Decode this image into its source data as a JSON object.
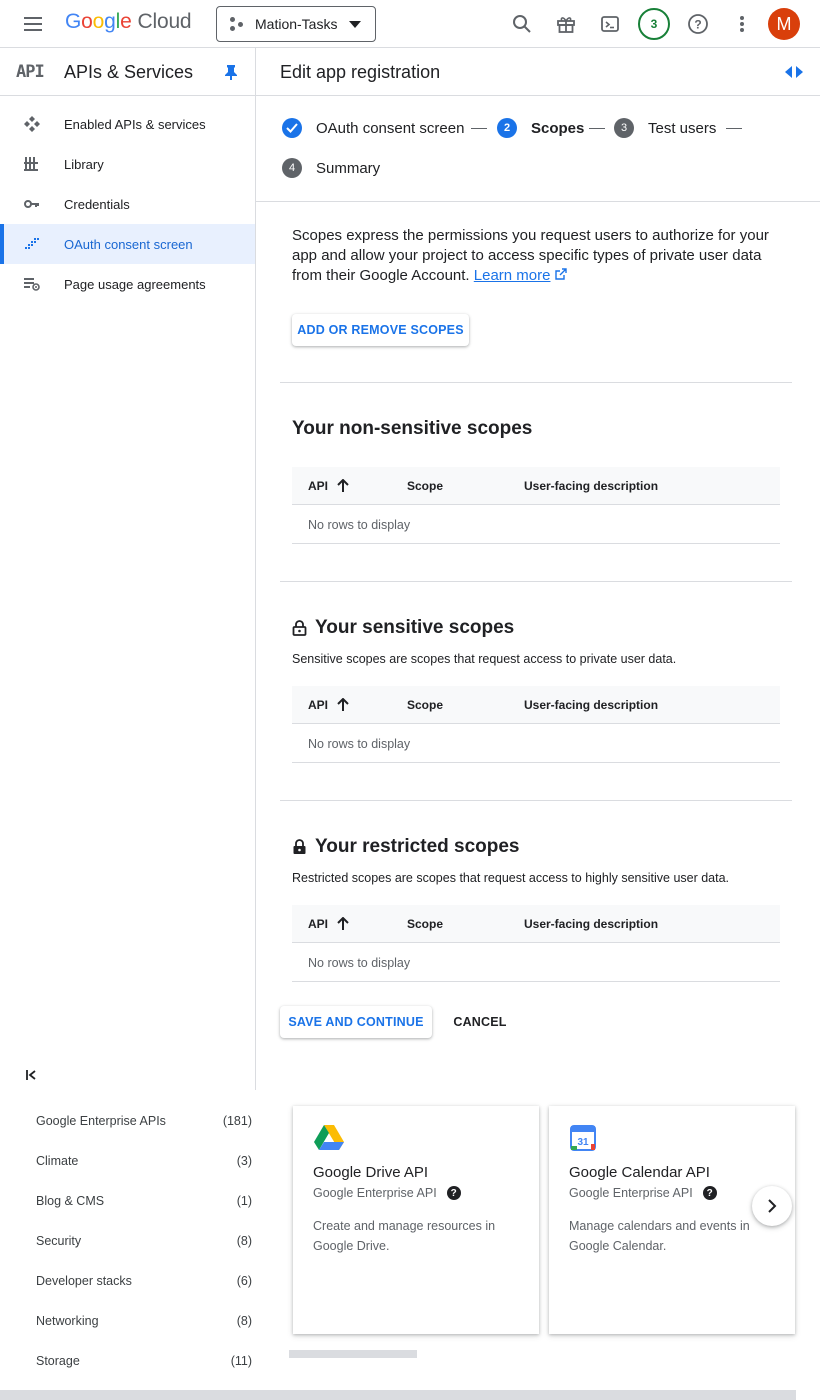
{
  "topbar": {
    "brand_google": "Google",
    "brand_cloud": "Cloud",
    "project_name": "Mation-Tasks",
    "notification_count": "3",
    "avatar_initial": "M"
  },
  "sidebar": {
    "title": "APIs & Services",
    "api_logo_text": "API",
    "items": [
      {
        "label": "Enabled APIs & services",
        "icon": "enabled-apis-icon"
      },
      {
        "label": "Library",
        "icon": "library-icon"
      },
      {
        "label": "Credentials",
        "icon": "key-icon"
      },
      {
        "label": "OAuth consent screen",
        "icon": "oauth-icon",
        "active": true
      },
      {
        "label": "Page usage agreements",
        "icon": "agreements-icon"
      }
    ],
    "collapse_label": "<I"
  },
  "main": {
    "title": "Edit app registration",
    "steps": [
      {
        "num": "",
        "label": "OAuth consent screen",
        "state": "done"
      },
      {
        "num": "2",
        "label": "Scopes",
        "state": "active"
      },
      {
        "num": "3",
        "label": "Test users",
        "state": "pending"
      },
      {
        "num": "4",
        "label": "Summary",
        "state": "pending"
      }
    ],
    "intro_text": "Scopes express the permissions you request users to authorize for your app and allow your project to access specific types of private user data from their Google Account.",
    "learn_more": "Learn more",
    "add_remove_button": "ADD OR REMOVE SCOPES",
    "sections": [
      {
        "title": "Your non-sensitive scopes",
        "description": "",
        "icon": ""
      },
      {
        "title": "Your sensitive scopes",
        "description": "Sensitive scopes are scopes that request access to private user data.",
        "icon": "lock-open-icon"
      },
      {
        "title": "Your restricted scopes",
        "description": "Restricted scopes are scopes that request access to highly sensitive user data.",
        "icon": "lock-icon"
      }
    ],
    "table_headers": {
      "api": "API",
      "scope": "Scope",
      "desc": "User-facing description"
    },
    "empty_text": "No rows to display",
    "save_button": "SAVE AND CONTINUE",
    "cancel_button": "CANCEL"
  },
  "categories": [
    {
      "name": "Google Enterprise APIs",
      "count": "(181)"
    },
    {
      "name": "Climate",
      "count": "(3)"
    },
    {
      "name": "Blog & CMS",
      "count": "(1)"
    },
    {
      "name": "Security",
      "count": "(8)"
    },
    {
      "name": "Developer stacks",
      "count": "(6)"
    },
    {
      "name": "Networking",
      "count": "(8)"
    },
    {
      "name": "Storage",
      "count": "(11)"
    }
  ],
  "cards": [
    {
      "name": "Google Drive API",
      "vendor": "Google Enterprise API",
      "description": "Create and manage resources in Google Drive."
    },
    {
      "name": "Google Calendar API",
      "vendor": "Google Enterprise API",
      "description": "Manage calendars and events in Google Calendar.",
      "calendar_day": "31"
    }
  ],
  "colors": {
    "accent": "#1a73e8",
    "step_done": "#1a73e8",
    "step_pending": "#5f6368",
    "avatar_bg": "#d93f0b",
    "badge_green": "#188038"
  }
}
